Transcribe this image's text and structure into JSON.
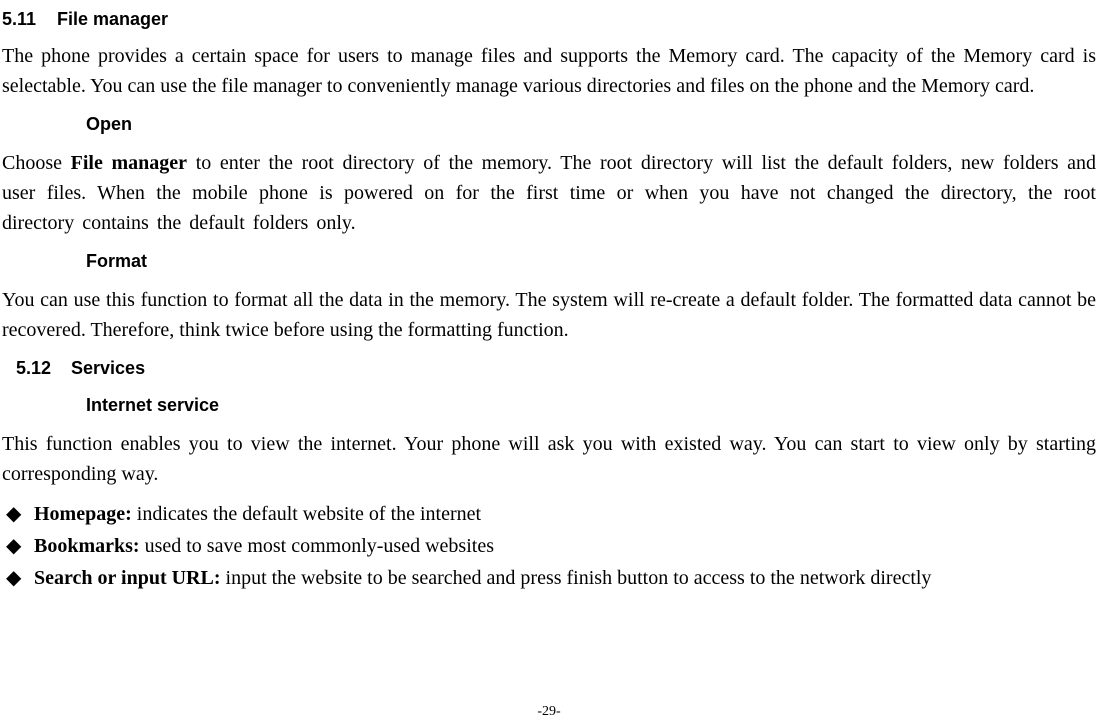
{
  "section511": {
    "number": "5.11",
    "title": "File manager",
    "intro": "The phone provides a certain space for users to manage files and supports the Memory card. The capacity of the Memory card is selectable. You can use the file manager to conveniently manage various directories and files on the phone and the Memory card.",
    "open": {
      "title": "Open",
      "text_prefix": "Choose ",
      "text_bold": "File manager",
      "text_suffix": " to enter the root directory of the memory. The root directory will list the default folders, new folders and user files. When the mobile phone is powered on for the first time or when you have not changed the directory, the root directory contains the default folders only."
    },
    "format": {
      "title": "Format",
      "text": "You can use this function to format all the data in the memory. The system will re-create a default folder. The formatted data cannot be recovered. Therefore, think twice before using the formatting function."
    }
  },
  "section512": {
    "number": "5.12",
    "title": "Services",
    "internet": {
      "title": "Internet service",
      "intro": "This function enables you to view the internet. Your phone will ask you with existed way. You can start to view only by starting corresponding way.",
      "bullets": [
        {
          "bold": "Homepage:",
          "text": " indicates the default website of the internet"
        },
        {
          "bold": "Bookmarks:",
          "text": " used to save most commonly-used websites"
        },
        {
          "bold": "Search or input URL:",
          "text": " input the website to be searched and press finish button to access to the network directly"
        }
      ]
    }
  },
  "bullet_glyph": "◆",
  "page_number": "-29-"
}
